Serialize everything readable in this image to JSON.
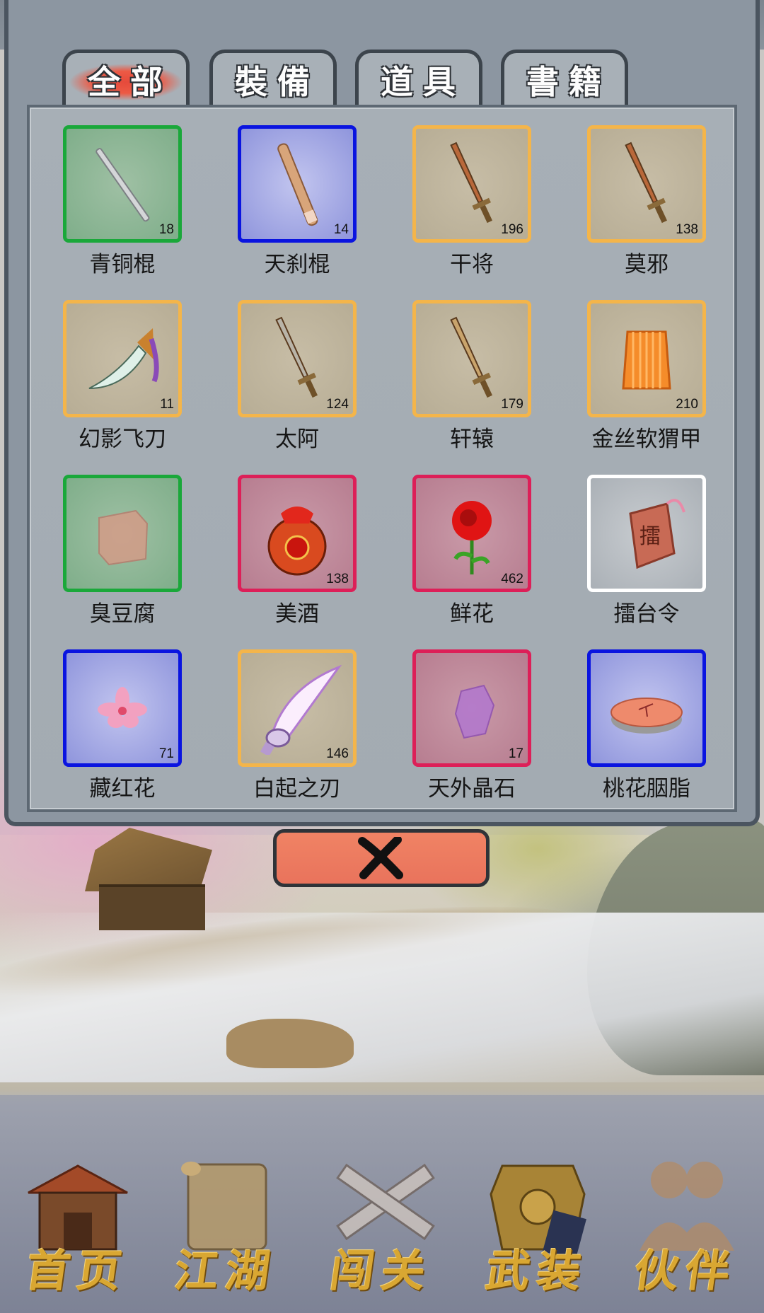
{
  "tabs": [
    {
      "label": "全部",
      "active": true
    },
    {
      "label": "裝備",
      "active": false
    },
    {
      "label": "道具",
      "active": false
    },
    {
      "label": "書籍",
      "active": false
    }
  ],
  "items": [
    {
      "name": "青铜棍",
      "count": "18",
      "rarity": "green",
      "icon": "staff-icon"
    },
    {
      "name": "天刹棍",
      "count": "14",
      "rarity": "blue",
      "icon": "staff-icon"
    },
    {
      "name": "干将",
      "count": "196",
      "rarity": "orange",
      "icon": "sword-icon"
    },
    {
      "name": "莫邪",
      "count": "138",
      "rarity": "orange",
      "icon": "sword-icon"
    },
    {
      "name": "幻影飞刀",
      "count": "11",
      "rarity": "orange",
      "icon": "flying-knife-icon"
    },
    {
      "name": "太阿",
      "count": "124",
      "rarity": "orange",
      "icon": "sword-icon"
    },
    {
      "name": "轩辕",
      "count": "179",
      "rarity": "orange",
      "icon": "sword-icon"
    },
    {
      "name": "金丝软猬甲",
      "count": "210",
      "rarity": "orange",
      "icon": "armor-icon"
    },
    {
      "name": "臭豆腐",
      "count": "",
      "rarity": "green",
      "icon": "tofu-icon"
    },
    {
      "name": "美酒",
      "count": "138",
      "rarity": "red",
      "icon": "wine-jar-icon"
    },
    {
      "name": "鲜花",
      "count": "462",
      "rarity": "red",
      "icon": "rose-icon"
    },
    {
      "name": "擂台令",
      "count": "",
      "rarity": "white",
      "icon": "token-icon"
    },
    {
      "name": "藏红花",
      "count": "71",
      "rarity": "blue",
      "icon": "flower-icon"
    },
    {
      "name": "白起之刃",
      "count": "146",
      "rarity": "orange",
      "icon": "blade-icon"
    },
    {
      "name": "天外晶石",
      "count": "17",
      "rarity": "red",
      "icon": "crystal-icon"
    },
    {
      "name": "桃花胭脂",
      "count": "",
      "rarity": "blue",
      "icon": "rouge-icon"
    }
  ],
  "close_button": {
    "icon": "close-icon"
  },
  "nav": [
    {
      "label": "首页",
      "icon": "home-icon"
    },
    {
      "label": "江湖",
      "icon": "scroll-icon"
    },
    {
      "label": "闯关",
      "icon": "crossed-swords-icon"
    },
    {
      "label": "武装",
      "icon": "armor-icon"
    },
    {
      "label": "伙伴",
      "icon": "partners-icon"
    }
  ],
  "colors": {
    "green": "#1aa83a",
    "blue": "#0a14e0",
    "orange": "#f4b54a",
    "red": "#dd1f58",
    "white": "#ffffff",
    "accent": "#e9735c",
    "nav_text": "#d9a732"
  }
}
